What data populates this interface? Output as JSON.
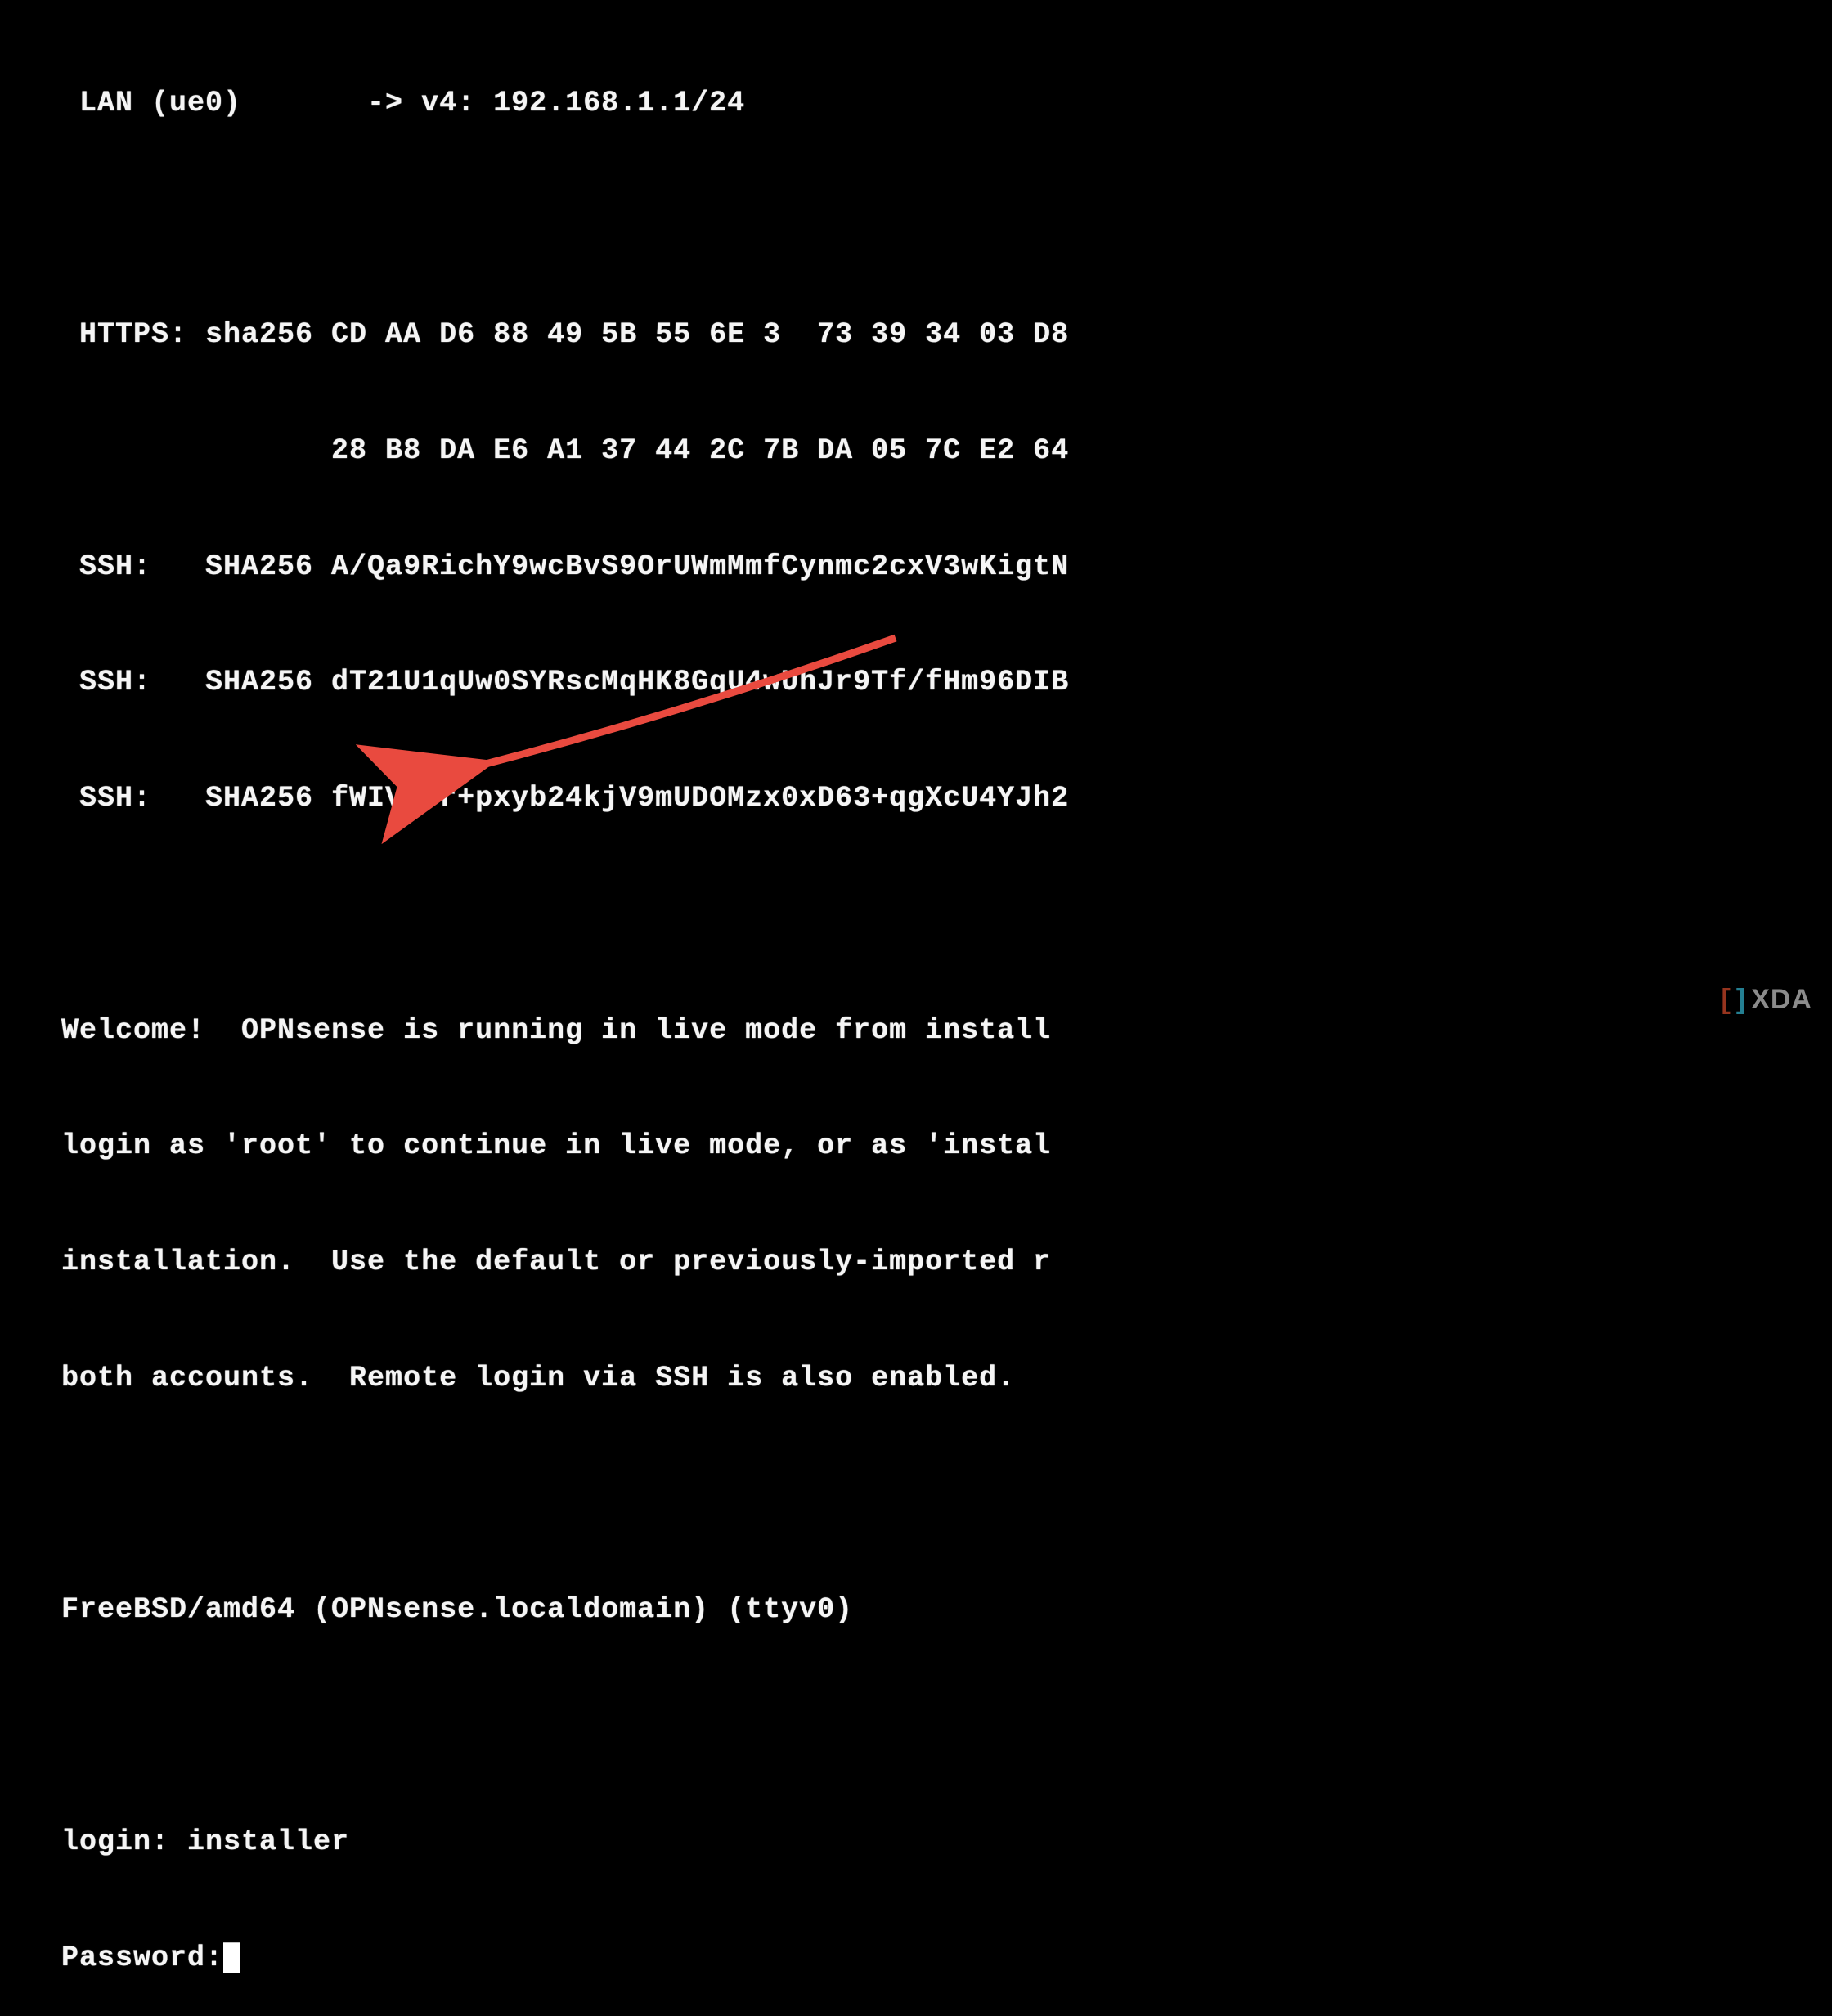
{
  "lines": {
    "lan": " LAN (ue0)       -> v4: 192.168.1.1/24",
    "blank1": "",
    "https1": " HTTPS: sha256 CD AA D6 88 49 5B 55 6E 3  73 39 34 03 D8",
    "https2": "               28 B8 DA E6 A1 37 44 2C 7B DA 05 7C E2 64",
    "ssh1": " SSH:   SHA256 A/Qa9RichY9wcBvS9OrUWmMmfCynmc2cxV3wKigtN",
    "ssh2": " SSH:   SHA256 dT21U1qUw0SYRscMqHK8GqU4wUhJr9Tf/fHm96DIB",
    "ssh3": " SSH:   SHA256 fWIVd3r+pxyb24kjV9mUDOMzx0xD63+qgXcU4YJh2",
    "blank2": "",
    "welcome1": "Welcome!  OPNsense is running in live mode from install ",
    "welcome2": "login as 'root' to continue in live mode, or as 'instal",
    "welcome3": "installation.  Use the default or previously-imported r",
    "welcome4": "both accounts.  Remote login via SSH is also enabled.",
    "blank3": "",
    "sysid": "FreeBSD/amd64 (OPNsense.localdomain) (ttyv0)",
    "blank4": "",
    "login_label": "login: ",
    "login_value": "installer",
    "password_label": "Password:"
  },
  "watermark": {
    "left_glyph": "[",
    "right_glyph": "]",
    "text": "XDA"
  },
  "colors": {
    "fg": "#f5f5f5",
    "bg": "#000000",
    "arrow": "#e94a3f"
  },
  "mouse_pointer_hint": "8"
}
